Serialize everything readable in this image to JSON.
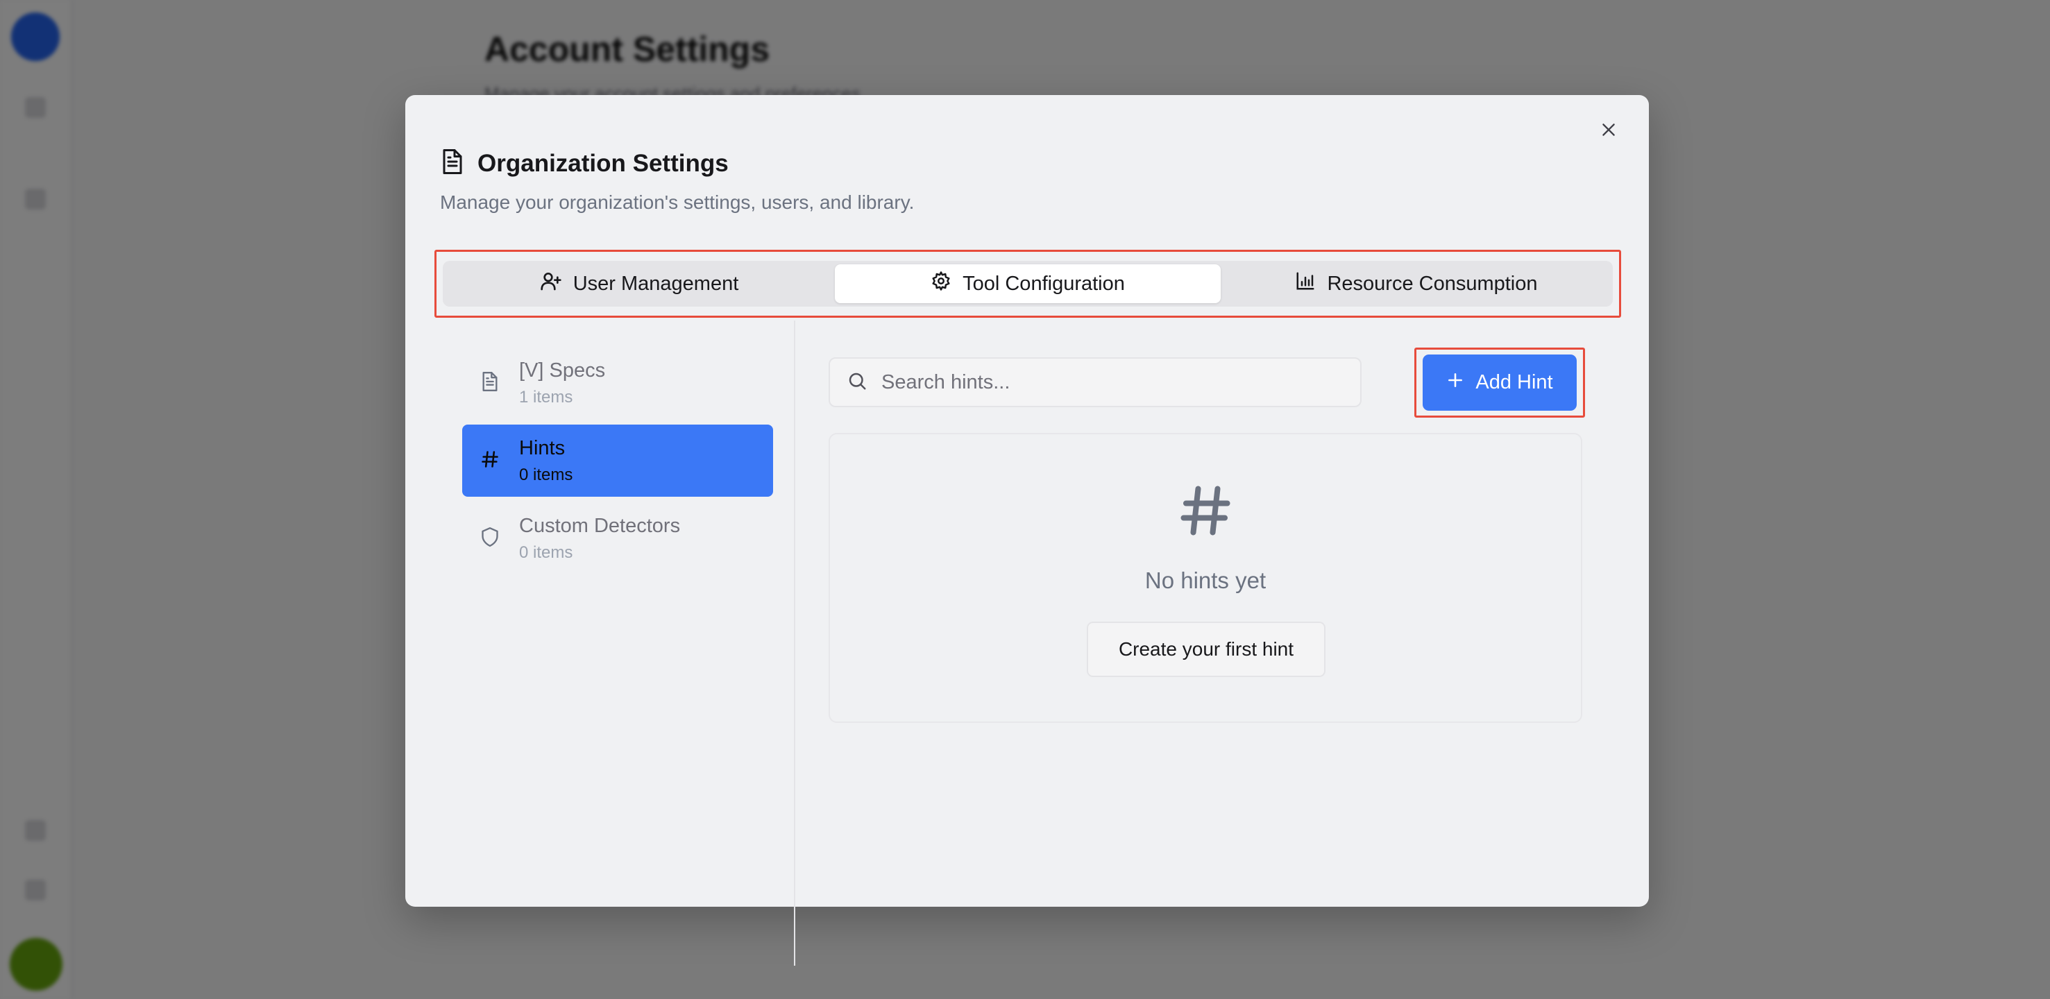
{
  "background": {
    "page_title": "Account Settings",
    "page_subtitle": "Manage your account settings and preferences."
  },
  "modal": {
    "title": "Organization Settings",
    "title_icon": "document-icon",
    "description": "Manage your organization's settings, users, and library.",
    "close_icon": "close-icon"
  },
  "tabs": [
    {
      "label": "User Management",
      "icon": "user-plus-icon",
      "active": false
    },
    {
      "label": "Tool Configuration",
      "icon": "gear-icon",
      "active": true
    },
    {
      "label": "Resource Consumption",
      "icon": "bar-chart-icon",
      "active": false
    }
  ],
  "sidebar": {
    "items": [
      {
        "label": "[V] Specs",
        "count": "1 items",
        "icon": "document-icon",
        "active": false
      },
      {
        "label": "Hints",
        "count": "0 items",
        "icon": "hash-icon",
        "active": true
      },
      {
        "label": "Custom Detectors",
        "count": "0 items",
        "icon": "shield-icon",
        "active": false
      }
    ]
  },
  "search": {
    "placeholder": "Search hints...",
    "value": ""
  },
  "add_button": {
    "label": "Add Hint",
    "icon": "plus-icon"
  },
  "empty_state": {
    "icon": "hash-icon",
    "message": "No hints yet",
    "action_label": "Create your first hint"
  },
  "colors": {
    "accent": "#3b78f6",
    "highlight_border": "#e74c3c"
  }
}
